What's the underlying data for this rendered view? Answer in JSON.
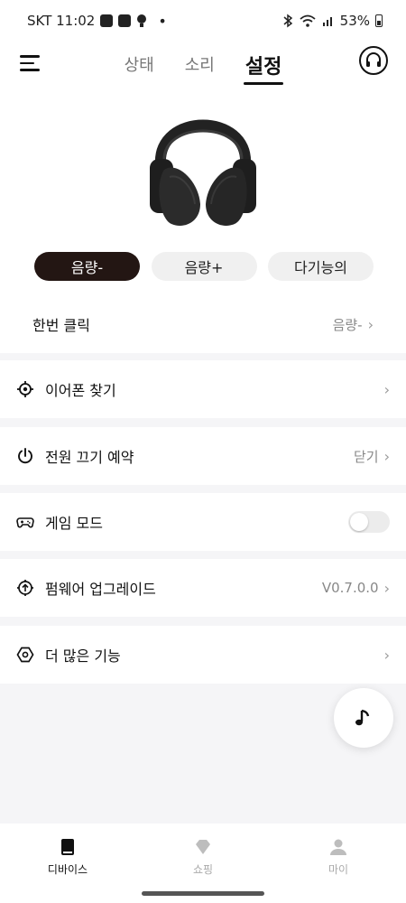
{
  "status_bar": {
    "carrier_time": "SKT 11:02",
    "battery": "53%"
  },
  "header": {
    "tabs": [
      {
        "label": "상태",
        "active": false
      },
      {
        "label": "소리",
        "active": false
      },
      {
        "label": "설정",
        "active": true
      }
    ]
  },
  "touch_controls": {
    "buttons": [
      {
        "label": "음량-",
        "active": true
      },
      {
        "label": "음량+",
        "active": false
      },
      {
        "label": "다기능의",
        "active": false
      }
    ],
    "single_click": {
      "label": "한번 클릭",
      "value": "음량-"
    }
  },
  "settings": [
    {
      "label": "이어폰 찾기",
      "value": "",
      "icon": "locate-icon"
    },
    {
      "label": "전원 끄기 예약",
      "value": "닫기",
      "icon": "power-icon"
    },
    {
      "label": "게임 모드",
      "value": "",
      "icon": "gamepad-icon",
      "toggle": false
    },
    {
      "label": "펌웨어 업그레이드",
      "value": "V0.7.0.0",
      "icon": "firmware-upgrade-icon"
    },
    {
      "label": "더 많은 기능",
      "value": "",
      "icon": "hexagon-icon"
    }
  ],
  "bottom_nav": [
    {
      "label": "디바이스",
      "active": true,
      "icon": "device-icon"
    },
    {
      "label": "쇼핑",
      "active": false,
      "icon": "diamond-icon"
    },
    {
      "label": "마이",
      "active": false,
      "icon": "person-icon"
    }
  ],
  "colors": {
    "accent_dark": "#231613",
    "background": "#f5f5f7"
  }
}
